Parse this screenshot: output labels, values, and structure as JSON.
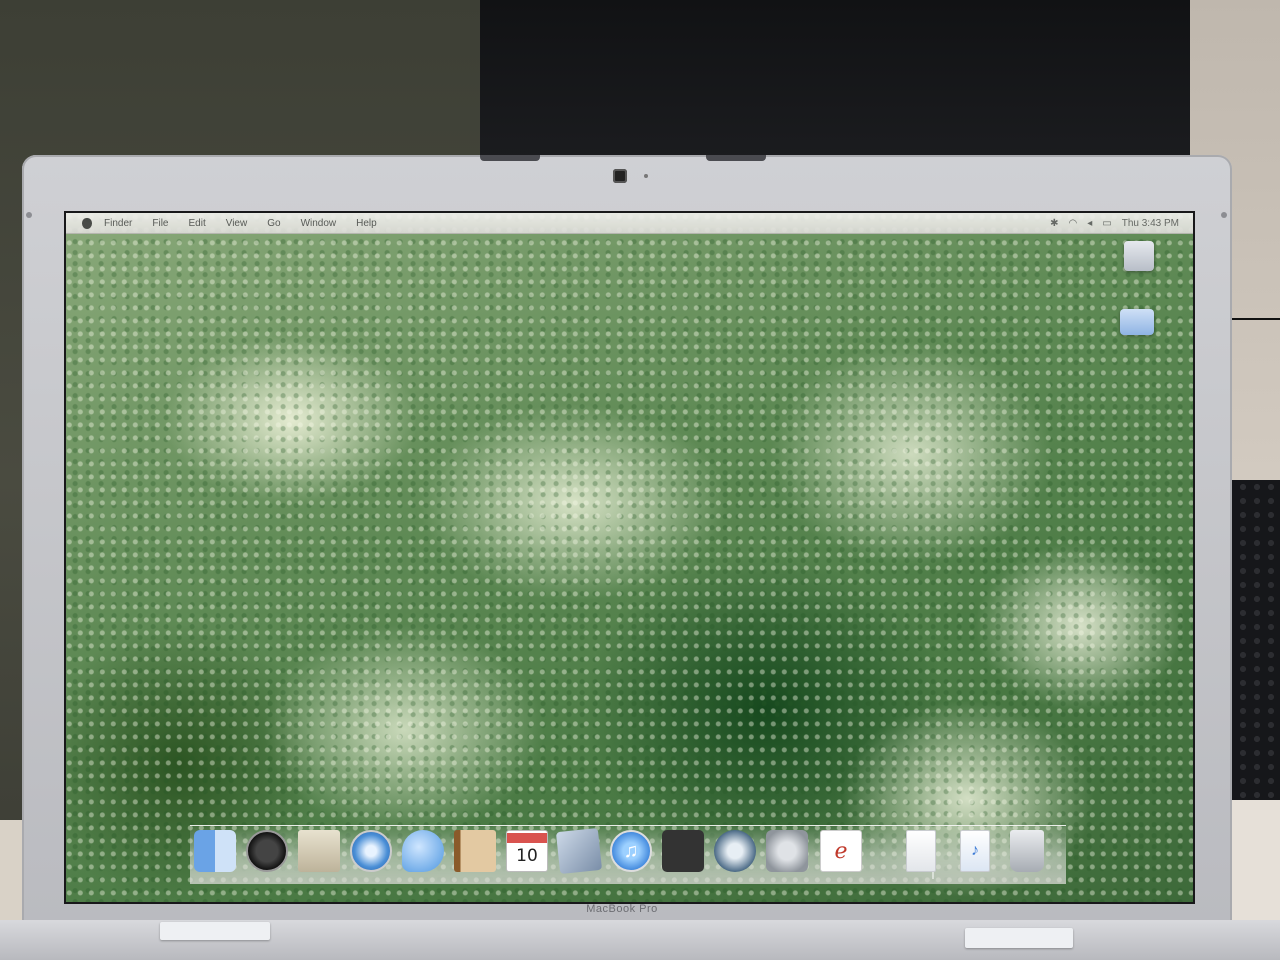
{
  "menubar": {
    "items": [
      "Finder",
      "File",
      "Edit",
      "View",
      "Go",
      "Window",
      "Help"
    ],
    "status_icons": [
      "bluetooth-icon",
      "wifi-icon",
      "volume-icon",
      "battery-icon"
    ],
    "clock": "Thu 3:43 PM"
  },
  "desktop": {
    "icons": [
      "hard-drive-icon",
      "folder-icon"
    ]
  },
  "dock": {
    "items": [
      {
        "name": "finder",
        "icon": "finder-icon"
      },
      {
        "name": "dashboard",
        "icon": "dashboard-icon"
      },
      {
        "name": "mail",
        "icon": "mail-icon"
      },
      {
        "name": "safari",
        "icon": "safari-icon"
      },
      {
        "name": "ichat",
        "icon": "ichat-icon"
      },
      {
        "name": "address-book",
        "icon": "address-book-icon"
      },
      {
        "name": "ical",
        "icon": "calendar-icon",
        "date": "10"
      },
      {
        "name": "iphoto",
        "icon": "iphoto-icon"
      },
      {
        "name": "itunes",
        "icon": "itunes-icon",
        "glyph": "♫"
      },
      {
        "name": "spaces",
        "icon": "spaces-icon"
      },
      {
        "name": "time-machine",
        "icon": "time-machine-icon"
      },
      {
        "name": "system-preferences",
        "icon": "system-preferences-icon"
      },
      {
        "name": "app",
        "icon": "red-swoosh-app-icon",
        "glyph": "ℯ"
      },
      {
        "name": "documents",
        "icon": "document-icon"
      },
      {
        "name": "music-document",
        "icon": "music-document-icon",
        "glyph": "♪"
      },
      {
        "name": "trash",
        "icon": "trash-icon"
      }
    ]
  },
  "hardware": {
    "brand": "MacBook Pro"
  },
  "colors": {
    "menubar": "#e8e7e3",
    "bezel": "#c9cacf",
    "wallpaper_light": "#e4ecd2",
    "wallpaper_dark": "#2f5a32"
  }
}
